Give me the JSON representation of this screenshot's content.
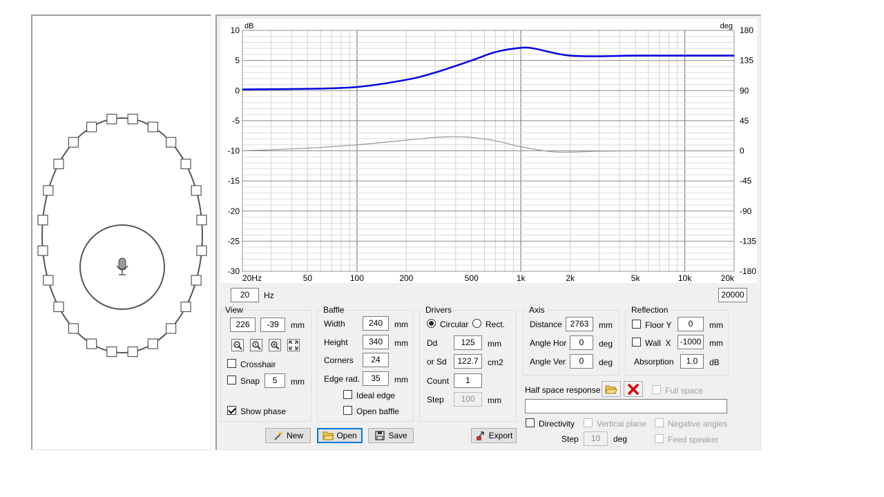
{
  "graph": {
    "y_left_unit": "dB",
    "y_right_unit": "deg",
    "y_left_ticks": [
      "10",
      "5",
      "0",
      "-5",
      "-10",
      "-15",
      "-20",
      "-25",
      "-30"
    ],
    "y_right_ticks": [
      "180",
      "135",
      "90",
      "45",
      "0",
      "-45",
      "-90",
      "-135",
      "-180"
    ],
    "x_tick_labels": [
      "20Hz",
      "50",
      "100",
      "200",
      "500",
      "1k",
      "2k",
      "5k",
      "10k",
      "20k"
    ],
    "freq_min": "20",
    "freq_min_unit": "Hz",
    "freq_max": "20000"
  },
  "chart_data": {
    "type": "line",
    "xscale": "log",
    "xlim": [
      20,
      20000
    ],
    "ylim": [
      -30,
      10
    ],
    "y2lim": [
      -180,
      180
    ],
    "grid": true,
    "series": [
      {
        "axis": "left",
        "color": "#0000e0",
        "x": [
          20,
          50,
          100,
          200,
          300,
          500,
          700,
          1000,
          1200,
          1500,
          2000,
          3000,
          5000,
          10000,
          20000
        ],
        "y": [
          0.2,
          0.3,
          0.6,
          1.8,
          3.0,
          5.0,
          6.4,
          7.1,
          7.0,
          6.4,
          5.8,
          5.7,
          5.8,
          5.8,
          5.8
        ]
      },
      {
        "axis": "right",
        "color": "#9a9a9a",
        "x": [
          20,
          50,
          100,
          200,
          300,
          400,
          500,
          700,
          1000,
          1500,
          2000,
          3000,
          5000,
          10000,
          20000
        ],
        "y": [
          0,
          4,
          9,
          16,
          20,
          21,
          20,
          15,
          6,
          -1,
          -2,
          -0.5,
          0,
          0,
          0
        ]
      }
    ]
  },
  "view": {
    "title": "View",
    "x": "226",
    "y": "-39",
    "unit": "mm",
    "crosshair_label": "Crosshair",
    "snap_label": "Snap",
    "snap_value": "5",
    "snap_unit": "mm",
    "show_phase_label": "Show phase"
  },
  "baffle": {
    "title": "Baffle",
    "width_label": "Width",
    "width": "240",
    "height_label": "Height",
    "height": "340",
    "corners_label": "Corners",
    "corners": "24",
    "edge_label": "Edge rad.",
    "edge": "35",
    "unit": "mm",
    "ideal_edge_label": "Ideal edge",
    "open_baffle_label": "Open baffle"
  },
  "drivers": {
    "title": "Drivers",
    "circular_label": "Circular",
    "rect_label": "Rect.",
    "dd_label": "Dd",
    "dd": "125",
    "dd_unit": "mm",
    "sd_label": "or Sd",
    "sd": "122.7",
    "sd_unit": "cm2",
    "count_label": "Count",
    "count": "1",
    "step_label": "Step",
    "step": "100",
    "step_unit": "mm"
  },
  "axis": {
    "title": "Axis",
    "distance_label": "Distance",
    "distance": "2763",
    "distance_unit": "mm",
    "hor_label": "Angle Hor",
    "hor": "0",
    "ver_label": "Angle Ver",
    "ver": "0",
    "deg": "deg"
  },
  "reflection": {
    "title": "Reflection",
    "floor_label": "Floor Y",
    "floor": "0",
    "wall_label": "Wall  X",
    "wall": "-1000",
    "unit": "mm",
    "absorption_label": "Absorption",
    "absorption": "1.0",
    "absorption_unit": "dB"
  },
  "halfspace": {
    "label": "Half space response",
    "full_space_label": "Full space",
    "path": ""
  },
  "directivity": {
    "label": "Directivity",
    "vertical_label": "Vertical plane",
    "negative_label": "Negative angles",
    "feed_label": "Feed speaker",
    "step_label": "Step",
    "step": "10",
    "deg": "deg"
  },
  "buttons": {
    "new": "New",
    "open": "Open",
    "save": "Save",
    "export": "Export"
  },
  "colors": {
    "magnitude": "#0000e0",
    "phase": "#9a9a9a",
    "delete": "#d40000"
  }
}
